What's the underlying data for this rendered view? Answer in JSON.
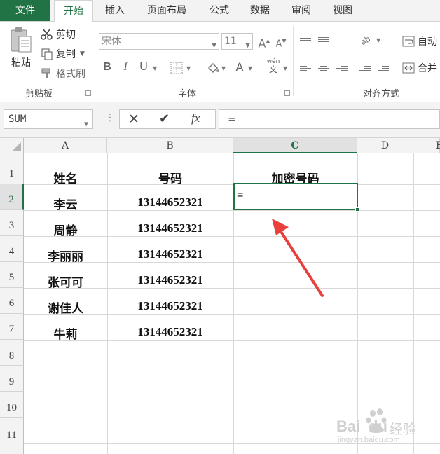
{
  "ribbon": {
    "tabs": [
      "文件",
      "开始",
      "插入",
      "页面布局",
      "公式",
      "数据",
      "审阅",
      "视图"
    ],
    "clipboard": {
      "paste_label": "粘贴",
      "cut_label": "剪切",
      "copy_label": "复制",
      "format_painter_label": "格式刷",
      "group_label": "剪贴板"
    },
    "font": {
      "font_name": "宋体",
      "font_size": "11",
      "bold": "B",
      "italic": "I",
      "underline": "U",
      "phonetic_top": "wén",
      "phonetic_bottom": "文",
      "group_label": "字体"
    },
    "alignment": {
      "wrap_label": "自动",
      "merge_label": "合并",
      "group_label": "对齐方式"
    }
  },
  "formula_bar": {
    "name_box": "SUM",
    "cancel_symbol": "✕",
    "enter_symbol": "✔",
    "fx_symbol": "fx",
    "content": "="
  },
  "sheet": {
    "columns": [
      "A",
      "B",
      "C",
      "D",
      "E"
    ],
    "rows": [
      "1",
      "2",
      "3",
      "4",
      "5",
      "6",
      "7",
      "8",
      "9",
      "10",
      "11"
    ],
    "headers": {
      "a": "姓名",
      "b": "号码",
      "c": "加密号码"
    },
    "data": [
      {
        "name": "李云",
        "phone": "13144652321"
      },
      {
        "name": "周静",
        "phone": "13144652321"
      },
      {
        "name": "李丽丽",
        "phone": "13144652321"
      },
      {
        "name": "张可可",
        "phone": "13144652321"
      },
      {
        "name": "谢佳人",
        "phone": "13144652321"
      },
      {
        "name": "牛莉",
        "phone": "13144652321"
      }
    ],
    "active_cell_text": "="
  },
  "watermark": {
    "brand": "Bai",
    "paw": "du",
    "suffix": "经验",
    "url": "jingyan.baidu.com"
  },
  "colors": {
    "accent": "#217346",
    "arrow": "#e8413d"
  }
}
